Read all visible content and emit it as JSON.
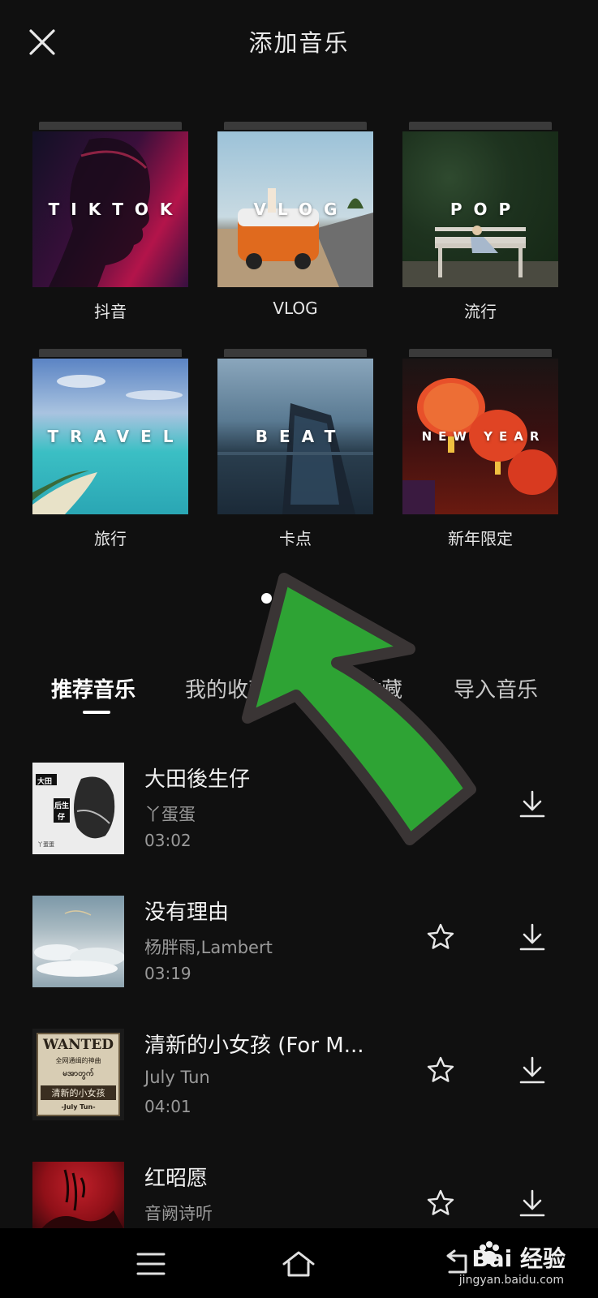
{
  "header": {
    "title": "添加音乐",
    "close_icon": "close-icon"
  },
  "categories": [
    {
      "label": "抖音",
      "cover_text": "TIKTOK"
    },
    {
      "label": "VLOG",
      "cover_text": "VLOG"
    },
    {
      "label": "流行",
      "cover_text": "POP"
    },
    {
      "label": "旅行",
      "cover_text": "TRAVEL"
    },
    {
      "label": "卡点",
      "cover_text": "BEAT"
    },
    {
      "label": "新年限定",
      "cover_text": "NEW YEAR"
    }
  ],
  "pager": {
    "page_count": 2,
    "active_index": 0
  },
  "tabs": [
    {
      "label": "推荐音乐",
      "active": true
    },
    {
      "label": "我的收藏",
      "active": false
    },
    {
      "label": "抖音收藏",
      "active": false
    },
    {
      "label": "导入音乐",
      "active": false
    }
  ],
  "songs": [
    {
      "title": "大田後生仔",
      "artist": "丫蛋蛋",
      "duration": "03:02",
      "has_star": false,
      "art_text": [
        "大田",
        "后生",
        "仔",
        "丫蛋蛋"
      ]
    },
    {
      "title": "没有理由",
      "artist": "杨胖雨,Lambert",
      "duration": "03:19",
      "has_star": true,
      "art_text": []
    },
    {
      "title": "清新的小女孩 (For M...",
      "artist": "July Tun",
      "duration": "04:01",
      "has_star": true,
      "art_text": [
        "WANTED",
        "全网通缉的神曲",
        "မအာတွက်",
        "清新的小女孩",
        "-July Tun-"
      ]
    },
    {
      "title": "红昭愿",
      "artist": "音阙诗听",
      "duration": "",
      "has_star": true,
      "art_text": []
    }
  ],
  "navbar": [
    "menu-icon",
    "home-icon",
    "back-icon"
  ],
  "watermark": {
    "brand": "Bai  经验",
    "url": "jingyan.baidu.com"
  },
  "colors": {
    "background": "#101010",
    "annotation_arrow": "#2ea334",
    "annotation_outline": "#3a3535"
  }
}
